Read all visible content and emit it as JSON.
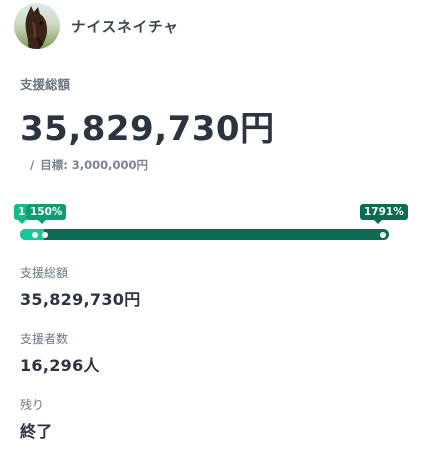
{
  "project": {
    "name": "ナイスネイチャ",
    "avatar_icon": "horse-photo"
  },
  "summary": {
    "total_label": "支援総額",
    "total_amount": "35,829,730円",
    "goal_slash": "/",
    "goal_text": "目標: 3,000,000円"
  },
  "progress": {
    "percent_achieved": 1791,
    "markers": [
      {
        "label": "1",
        "color": "#14b98c"
      },
      {
        "label": "150%",
        "color": "#0f9b74"
      },
      {
        "label": "1791%",
        "color": "#0c6b52"
      }
    ],
    "colors": {
      "track": "#0c6b52",
      "first_segment": "#17c89a"
    }
  },
  "stats": {
    "total": {
      "label": "支援総額",
      "value": "35,829,730円"
    },
    "supporters": {
      "label": "支援者数",
      "value": "16,296人"
    },
    "remaining": {
      "label": "残り",
      "value": "終了"
    }
  }
}
